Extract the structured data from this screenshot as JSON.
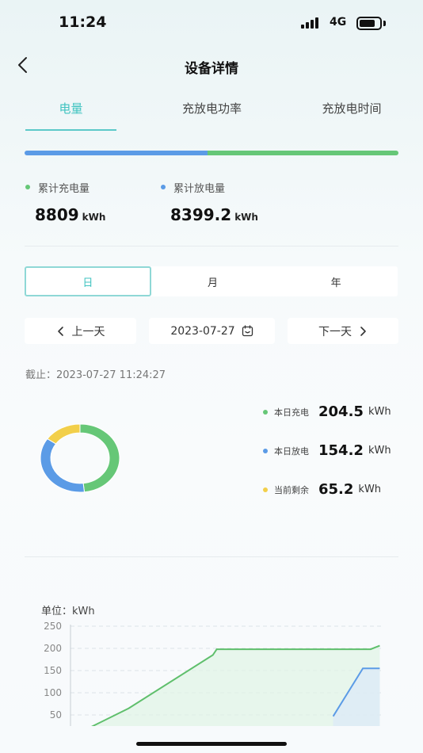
{
  "status": {
    "time": "11:24",
    "network": "4G"
  },
  "nav": {
    "title": "设备详情",
    "back_icon": "chevron-left-icon"
  },
  "tabs": [
    {
      "label": "电量",
      "active": true
    },
    {
      "label": "充放电功率",
      "active": false
    },
    {
      "label": "充放电时间",
      "active": false
    }
  ],
  "totals": {
    "charge": {
      "label": "累计充电量",
      "value": "8809",
      "unit": "kWh",
      "color": "#66c777"
    },
    "discharge": {
      "label": "累计放电量",
      "value": "8399.2",
      "unit": "kWh",
      "color": "#5b9be6"
    },
    "progress_blue_fraction": 0.49
  },
  "period": {
    "options": [
      "日",
      "月",
      "年"
    ],
    "selected": "日"
  },
  "date_nav": {
    "prev_label": "上一天",
    "date": "2023-07-27",
    "next_label": "下一天"
  },
  "asof": "截止：2023-07-27 11:24:27",
  "daily": [
    {
      "label": "本日充电",
      "value": "204.5",
      "unit": "kWh",
      "color": "#66c777"
    },
    {
      "label": "本日放电",
      "value": "154.2",
      "unit": "kWh",
      "color": "#5b9be6"
    },
    {
      "label": "当前剩余",
      "value": "65.2",
      "unit": "kWh",
      "color": "#f2cf4a"
    }
  ],
  "chart_data": [
    {
      "type": "pie",
      "donut": true,
      "slices": [
        {
          "name": "本日充电",
          "value": 204.5,
          "color": "#66c777"
        },
        {
          "name": "本日放电",
          "value": 154.2,
          "color": "#5b9be6"
        },
        {
          "name": "当前剩余",
          "value": 65.2,
          "color": "#f2cf4a"
        }
      ]
    },
    {
      "type": "line",
      "unit_label": "单位：kWh",
      "yticks": [
        "250",
        "200",
        "150",
        "100",
        "50"
      ],
      "ylim": [
        0,
        250
      ],
      "xlim": [
        0,
        24
      ],
      "grid": true,
      "series": [
        {
          "color": "#5fbf6c",
          "fill": "#dff4e5",
          "points": [
            [
              0,
              0
            ],
            [
              4.5,
              65
            ],
            [
              11,
              185
            ],
            [
              11.3,
              198
            ],
            [
              23.2,
              198
            ],
            [
              23.9,
              206
            ]
          ]
        },
        {
          "color": "#5b9be6",
          "fill": "#dce9fa",
          "points": [
            [
              20.3,
              47
            ],
            [
              22.6,
              155
            ],
            [
              23.9,
              155
            ]
          ]
        }
      ]
    }
  ]
}
